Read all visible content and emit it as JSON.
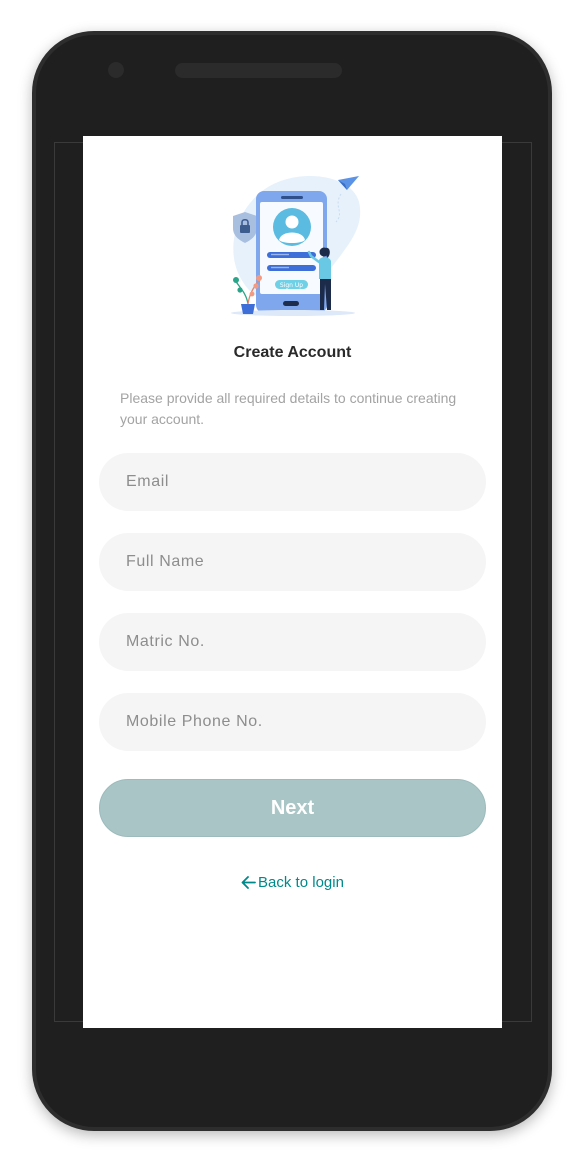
{
  "header": {
    "title": "Create Account",
    "subtitle": "Please provide all required details to continue creating your account."
  },
  "illustration": {
    "button_text": "Sign Up"
  },
  "form": {
    "email": {
      "value": "",
      "placeholder": "Email"
    },
    "full_name": {
      "value": "",
      "placeholder": "Full Name"
    },
    "matric_no": {
      "value": "",
      "placeholder": "Matric No."
    },
    "mobile_phone": {
      "value": "",
      "placeholder": "Mobile Phone No."
    }
  },
  "actions": {
    "next_label": "Next",
    "back_label": "Back to login"
  },
  "icons": {
    "back": "arrow-left-icon",
    "lock": "lock-icon",
    "user": "user-avatar-icon",
    "plane": "paper-plane-icon"
  },
  "colors": {
    "accent": "#00898b",
    "next_button": "#a9c5c6",
    "field_background": "#f5f5f5",
    "device_body": "#1f1f1f"
  }
}
